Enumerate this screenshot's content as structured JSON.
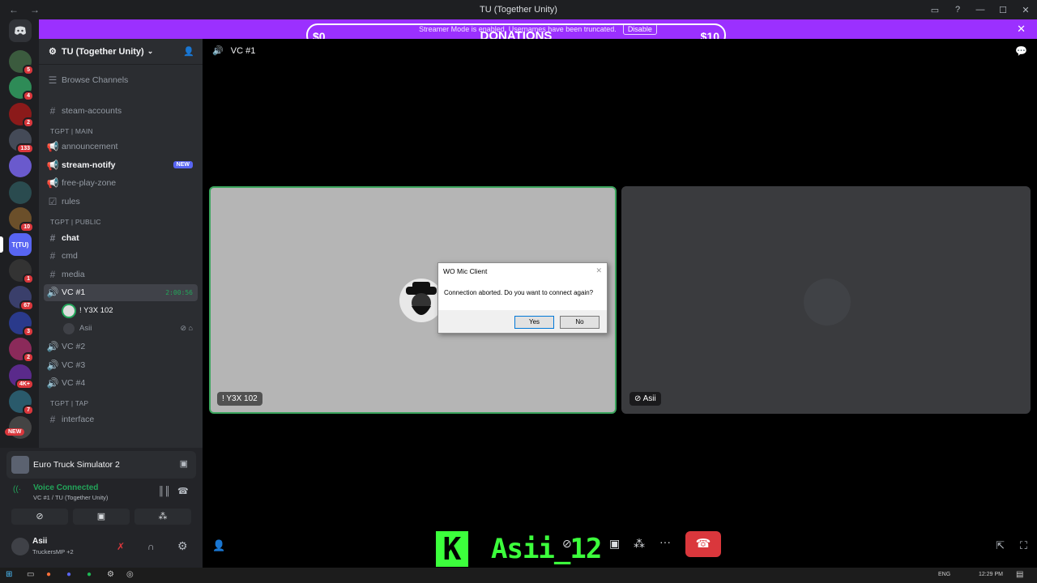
{
  "window": {
    "title": "TU (Together Unity)",
    "back_glyph": "←",
    "forward_glyph": "→",
    "controls": [
      "▭",
      "?",
      "—",
      "☐",
      "✕"
    ]
  },
  "banner": {
    "message": "Streamer Mode is enabled. Usernames have been truncated.",
    "disable_label": "Disable",
    "close_glyph": "✕",
    "color": "#9b30ff"
  },
  "donation": {
    "title": "DONATIONS",
    "current": "$0",
    "goal": "$10"
  },
  "rail": {
    "servers": [
      {
        "name": "server-1",
        "badge": "5",
        "color": "#3b5b3e"
      },
      {
        "name": "server-2",
        "badge": "4",
        "color": "#2e8b57"
      },
      {
        "name": "server-3",
        "badge": "2",
        "color": "#8b1a1a"
      },
      {
        "name": "server-4",
        "badge": "133",
        "color": "#444a57"
      },
      {
        "name": "server-5",
        "badge": "",
        "color": "#6a5acd"
      },
      {
        "name": "server-6",
        "badge": "",
        "color": "#2a4b4f"
      },
      {
        "name": "server-7",
        "badge": "10",
        "color": "#6b4f2a"
      },
      {
        "name": "server-tu",
        "badge": "",
        "color": "#5865f2",
        "label": "T(TU)"
      },
      {
        "name": "server-8",
        "badge": "1",
        "color": "#333"
      },
      {
        "name": "server-9",
        "badge": "67",
        "color": "#3a3f6b"
      },
      {
        "name": "server-10",
        "badge": "3",
        "color": "#2a3a8b"
      },
      {
        "name": "server-11",
        "badge": "2",
        "color": "#8b2a5a"
      },
      {
        "name": "server-12",
        "badge": "4K+",
        "color": "#5a2a8b"
      },
      {
        "name": "server-13",
        "badge": "7",
        "color": "#2a5a6b"
      },
      {
        "name": "server-14",
        "badge": "",
        "color": "#444"
      }
    ],
    "new_badge": "NEW"
  },
  "sidebar": {
    "server_name": "TU (Together Unity)",
    "browse_channels": "Browse Channels",
    "channels": [
      {
        "label": "steam-accounts",
        "icon": "#"
      },
      {
        "category": "TGPT | main"
      },
      {
        "label": "announcement",
        "icon": "📢"
      },
      {
        "label": "stream-notify",
        "icon": "📢",
        "bold": true,
        "badge": "NEW"
      },
      {
        "label": "free-play-zone",
        "icon": "📢"
      },
      {
        "label": "rules",
        "icon": "☑"
      },
      {
        "category": "TGPT | PUBLIC"
      },
      {
        "label": "chat",
        "icon": "#",
        "bold": true
      },
      {
        "label": "cmd",
        "icon": "#"
      },
      {
        "label": "media",
        "icon": "#"
      },
      {
        "label": "VC #1",
        "icon": "🔊",
        "selected": true,
        "timer": "2:00:56"
      },
      {
        "label": "VC #2",
        "icon": "🔊"
      },
      {
        "label": "VC #3",
        "icon": "🔊"
      },
      {
        "label": "VC #4",
        "icon": "🔊"
      },
      {
        "category": "TGPT | TAP"
      },
      {
        "label": "interface",
        "icon": "#"
      }
    ],
    "voice_members": [
      "! Y3X 102",
      "Asii"
    ]
  },
  "panel": {
    "activity_name": "Euro Truck Simulator 2",
    "voice_status": "Voice Connected",
    "voice_channel": "VC #1 / TU (Together Unity)",
    "user_name": "Asii",
    "user_status": "TruckersMP +2"
  },
  "main": {
    "channel_name": "VC #1",
    "tiles": [
      {
        "label": "! Y3X 102",
        "bg": "#b5b5b5",
        "border": "#3ba55d"
      },
      {
        "label": "Asii",
        "bg": "#3a3b3e",
        "border": "#3a3b3e"
      }
    ]
  },
  "dialog": {
    "title": "WO Mic Client",
    "message": "Connection aborted. Do you want to connect again?",
    "yes_label": "Yes",
    "no_label": "No"
  },
  "overlay": {
    "letter": "K",
    "name": "Asii_12"
  },
  "taskbar": {
    "lang": "ENG",
    "time": "12:29 PM"
  }
}
